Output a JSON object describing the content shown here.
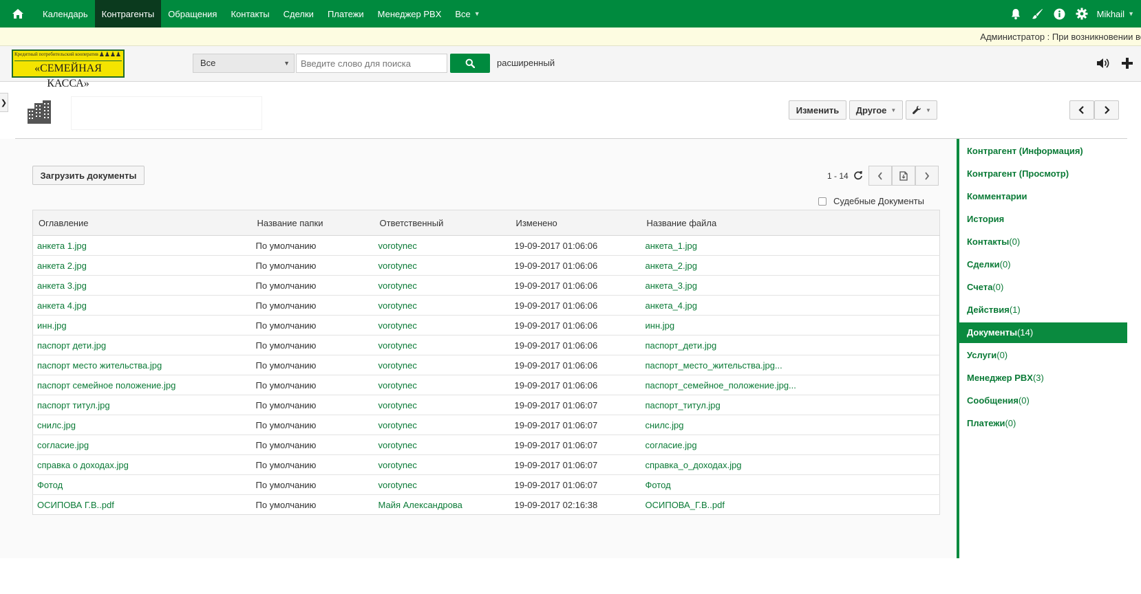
{
  "nav": {
    "home_icon": "home-icon",
    "items": [
      {
        "label": "Календарь"
      },
      {
        "label": "Контрагенты",
        "active": true
      },
      {
        "label": "Обращения"
      },
      {
        "label": "Контакты"
      },
      {
        "label": "Сделки"
      },
      {
        "label": "Платежи"
      },
      {
        "label": "Менеджер PBX"
      },
      {
        "label": "Все"
      }
    ],
    "icons": [
      "bell-icon",
      "brush-icon",
      "info-icon",
      "gear-icon"
    ],
    "user": "Mikhail"
  },
  "notice": "Администратор : При возникновении во",
  "header": {
    "logo_small": "Кредитный потребительский кооператив",
    "logo_big": "«СЕМЕЙНАЯ КАССА»",
    "scope": "Все",
    "search_placeholder": "Введите слово для поиска",
    "advanced": "расширенный"
  },
  "record": {
    "edit_label": "Изменить",
    "other_label": "Другое"
  },
  "docs": {
    "upload_label": "Загрузить документы",
    "pager": "1 - 14",
    "court_docs_label": "Судебные Документы",
    "columns": [
      "Оглавление",
      "Название папки",
      "Ответственный",
      "Изменено",
      "Название файла"
    ],
    "rows": [
      [
        "анкета 1.jpg",
        "По умолчанию",
        "vorotynec",
        "19-09-2017 01:06:06",
        "анкета_1.jpg"
      ],
      [
        "анкета 2.jpg",
        "По умолчанию",
        "vorotynec",
        "19-09-2017 01:06:06",
        "анкета_2.jpg"
      ],
      [
        "анкета 3.jpg",
        "По умолчанию",
        "vorotynec",
        "19-09-2017 01:06:06",
        "анкета_3.jpg"
      ],
      [
        "анкета 4.jpg",
        "По умолчанию",
        "vorotynec",
        "19-09-2017 01:06:06",
        "анкета_4.jpg"
      ],
      [
        "инн.jpg",
        "По умолчанию",
        "vorotynec",
        "19-09-2017 01:06:06",
        "инн.jpg"
      ],
      [
        "паспорт дети.jpg",
        "По умолчанию",
        "vorotynec",
        "19-09-2017 01:06:06",
        "паспорт_дети.jpg"
      ],
      [
        "паспорт место жительства.jpg",
        "По умолчанию",
        "vorotynec",
        "19-09-2017 01:06:06",
        "паспорт_место_жительства.jpg..."
      ],
      [
        "паспорт семейное положение.jpg",
        "По умолчанию",
        "vorotynec",
        "19-09-2017 01:06:06",
        "паспорт_семейное_положение.jpg..."
      ],
      [
        "паспорт титул.jpg",
        "По умолчанию",
        "vorotynec",
        "19-09-2017 01:06:07",
        "паспорт_титул.jpg"
      ],
      [
        "снилс.jpg",
        "По умолчанию",
        "vorotynec",
        "19-09-2017 01:06:07",
        "снилс.jpg"
      ],
      [
        "согласие.jpg",
        "По умолчанию",
        "vorotynec",
        "19-09-2017 01:06:07",
        "согласие.jpg"
      ],
      [
        "справка о доходах.jpg",
        "По умолчанию",
        "vorotynec",
        "19-09-2017 01:06:07",
        "справка_о_доходах.jpg"
      ],
      [
        "Фотод",
        "По умолчанию",
        "vorotynec",
        "19-09-2017 01:06:07",
        "Фотод"
      ],
      [
        "ОСИПОВА Г.В..pdf",
        "По умолчанию",
        "Майя Александрова",
        "19-09-2017 02:16:38",
        "ОСИПОВА_Г.В..pdf"
      ]
    ]
  },
  "sidebar": {
    "items": [
      {
        "label": "Контрагент (Информация)",
        "count": ""
      },
      {
        "label": "Контрагент (Просмотр)",
        "count": ""
      },
      {
        "label": "Комментарии",
        "count": ""
      },
      {
        "label": "История",
        "count": ""
      },
      {
        "label": "Контакты",
        "count": "(0)"
      },
      {
        "label": "Сделки",
        "count": "(0)"
      },
      {
        "label": "Счета",
        "count": "(0)"
      },
      {
        "label": "Действия",
        "count": "(1)"
      },
      {
        "label": "Документы",
        "count": "(14)",
        "active": true
      },
      {
        "label": "Услуги",
        "count": "(0)"
      },
      {
        "label": "Менеджер PBX",
        "count": "(3)"
      },
      {
        "label": "Сообщения",
        "count": "(0)"
      },
      {
        "label": "Платежи",
        "count": "(0)"
      }
    ]
  },
  "colors": {
    "brand": "#008a3e",
    "link": "#0a7a36",
    "nav_active": "#0b3a1e",
    "notice_bg": "#fdfce1"
  }
}
